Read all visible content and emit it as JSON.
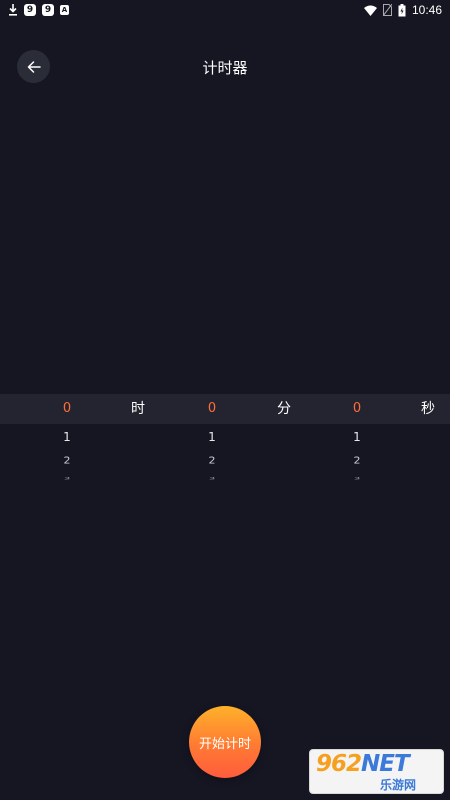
{
  "status_bar": {
    "time": "10:46",
    "badges": [
      "9",
      "9",
      "A"
    ],
    "icons": [
      "download-icon",
      "wifi-icon",
      "no-sim-icon",
      "battery-icon"
    ]
  },
  "header": {
    "title": "计时器",
    "back_icon": "arrow-left-icon"
  },
  "picker": {
    "columns": [
      {
        "selected": "0",
        "unit": "时",
        "options": [
          "1",
          "2",
          "3"
        ]
      },
      {
        "selected": "0",
        "unit": "分",
        "options": [
          "1",
          "2",
          "3"
        ]
      },
      {
        "selected": "0",
        "unit": "秒",
        "options": [
          "1",
          "2",
          "3"
        ]
      }
    ]
  },
  "start_button": {
    "label": "开始计时"
  },
  "watermark": {
    "number": "962",
    "suffix": "NET",
    "caption": "乐游网"
  },
  "colors": {
    "background": "#151622",
    "selected_value": "#ff6d3a",
    "button_top": "#ffb12a",
    "button_bottom": "#ff5c3d"
  }
}
